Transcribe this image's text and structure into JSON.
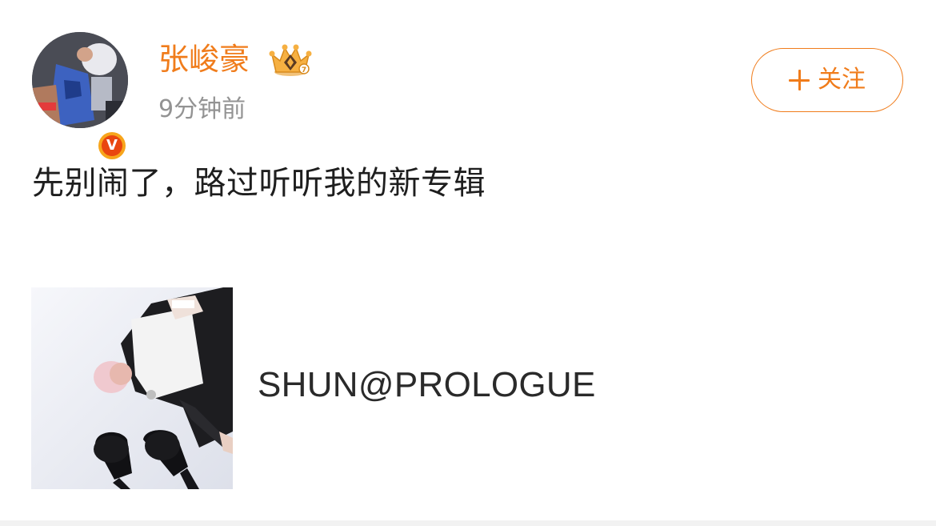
{
  "post": {
    "author": {
      "name": "张峻豪",
      "verified_mark": "V",
      "crown_badge": "crown-icon"
    },
    "timestamp": "9分钟前",
    "follow_button": {
      "label": "关注",
      "icon": "plus-icon"
    },
    "text": "先别闹了，路过听听我的新专辑",
    "album": {
      "title": "SHUN@PROLOGUE"
    }
  },
  "colors": {
    "accent": "#f07c1b",
    "timestamp": "#939393",
    "text": "#1e1e1e",
    "verified_outer": "#f7a51b",
    "verified_inner": "#e9460f"
  }
}
